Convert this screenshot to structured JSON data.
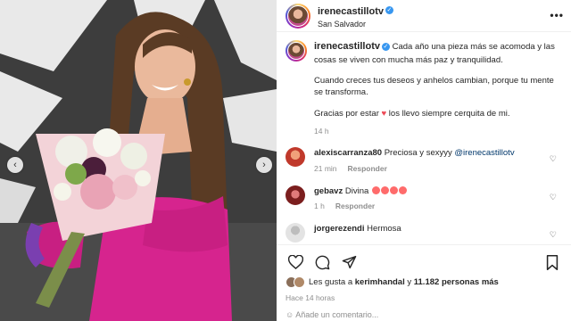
{
  "post": {
    "username": "irenecastillotv",
    "location": "San Salvador",
    "caption_lines": [
      "Cada año una pieza más se acomoda y las cosas se viven con mucha más paz y tranquilidad.",
      "Cuando creces tus deseos y anhelos cambian, porque tu mente se transforma.",
      "Gracias por estar",
      "los llevo siempre cerquita de mi."
    ],
    "caption_time": "14 h",
    "more_icon": "more-horizontal-icon",
    "verified_glyph": "✓"
  },
  "comments": [
    {
      "user": "alexiscarranza80",
      "text": "Preciosa y sexyyy",
      "mention": "@irenecastillotv",
      "time": "21 min",
      "reply": "Responder",
      "avatar_color": "#c0392b"
    },
    {
      "user": "gebavz",
      "text": "Divina",
      "time": "1 h",
      "reply": "Responder",
      "avatar_color": "#7b1e1e",
      "emoji_count": 4
    },
    {
      "user": "jorgerezendi",
      "text": "Hermosa",
      "avatar_color": "#d8d8d8"
    }
  ],
  "actions": {
    "liked_by_prefix": "Les gusta a",
    "liked_by_user": "kerimhandal",
    "liked_by_joiner": "y",
    "likes_others": "11.182 personas más",
    "posted_time": "Hace 14 horas",
    "add_comment": "Añade un comentario..."
  },
  "icons": {
    "heart": "heart-icon",
    "comment": "comment-icon",
    "share": "share-icon",
    "save": "bookmark-icon",
    "prev": "chevron-left-icon",
    "next": "chevron-right-icon"
  },
  "colors": {
    "dress": "#d6248e",
    "verified": "#3897f0",
    "heart": "#ed4956"
  }
}
